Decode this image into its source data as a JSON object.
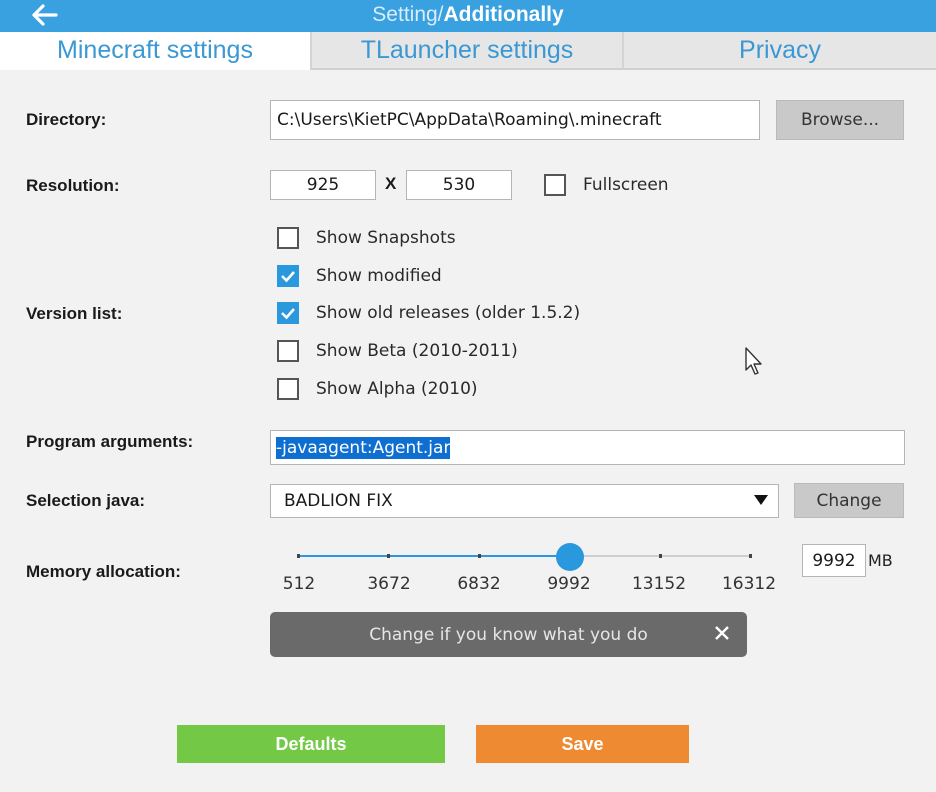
{
  "header": {
    "title_part1": "Setting/",
    "title_part2": "Additionally",
    "color": "#3aa1e0"
  },
  "tabs": [
    {
      "label": "Minecraft settings",
      "active": true
    },
    {
      "label": "TLauncher settings",
      "active": false
    },
    {
      "label": "Privacy",
      "active": false
    }
  ],
  "directory": {
    "label": "Directory:",
    "value": "C:\\Users\\KietPC\\AppData\\Roaming\\.minecraft",
    "browse_label": "Browse..."
  },
  "resolution": {
    "label": "Resolution:",
    "width": "925",
    "separator": "X",
    "height": "530",
    "fullscreen_label": "Fullscreen",
    "fullscreen_checked": false
  },
  "version_list": {
    "label": "Version list:",
    "options": [
      {
        "label": "Show Snapshots",
        "checked": false
      },
      {
        "label": "Show modified",
        "checked": true
      },
      {
        "label": "Show old releases (older 1.5.2)",
        "checked": true
      },
      {
        "label": "Show Beta (2010-2011)",
        "checked": false
      },
      {
        "label": "Show Alpha (2010)",
        "checked": false
      }
    ]
  },
  "program_arguments": {
    "label": "Program arguments:",
    "value": "-javaagent:Agent.jar"
  },
  "selection_java": {
    "label": "Selection java:",
    "value": "BADLION FIX",
    "change_label": "Change"
  },
  "memory": {
    "label": "Memory allocation:",
    "ticks": [
      "512",
      "3672",
      "6832",
      "9992",
      "13152",
      "16312"
    ],
    "value": "9992",
    "current_mb": 9992,
    "min_mb": 512,
    "max_mb": 16312,
    "unit": "MB",
    "accent": "#2a98dc"
  },
  "notice": {
    "text": "Change if you know what you do"
  },
  "buttons": {
    "defaults_label": "Defaults",
    "save_label": "Save",
    "defaults_color": "#73c946",
    "save_color": "#ed8a32"
  }
}
